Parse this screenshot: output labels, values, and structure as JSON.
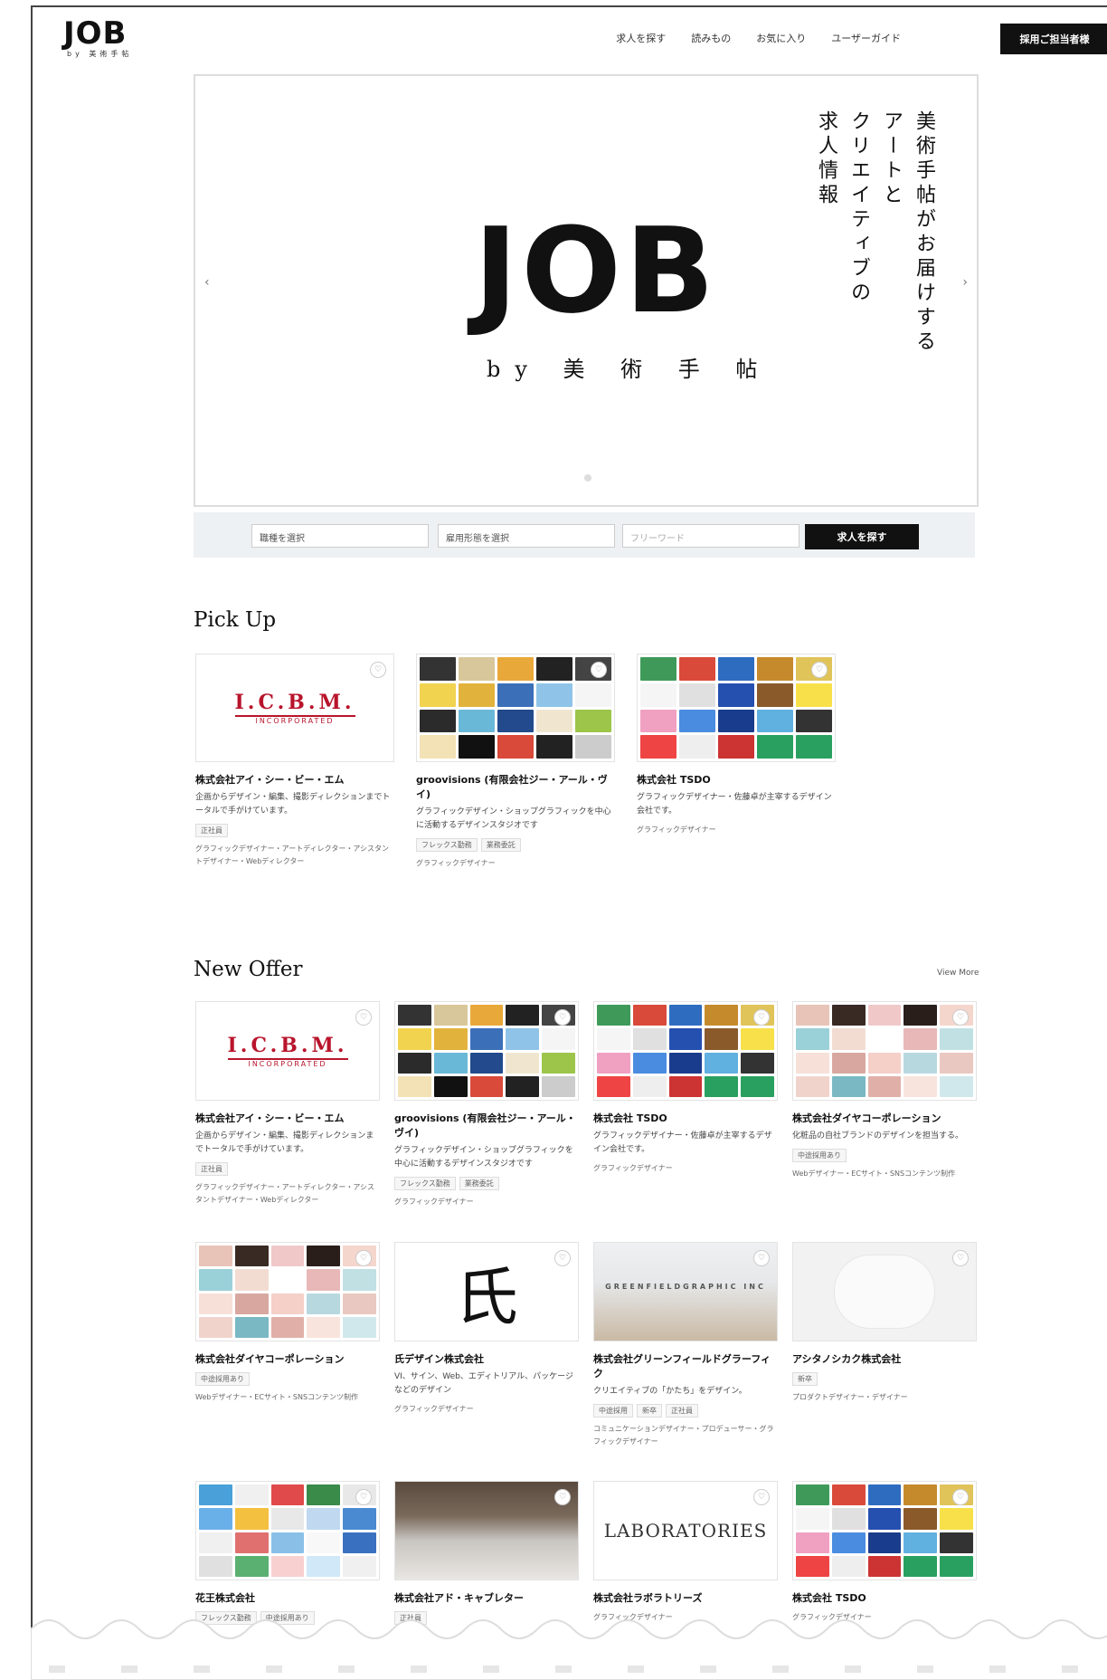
{
  "header": {
    "logo": "JOB",
    "logo_sub": "by 美術手帖",
    "nav": [
      "求人を探す",
      "読みもの",
      "お気に入り",
      "ユーザーガイド"
    ],
    "cta": "採用ご担当者様"
  },
  "hero": {
    "title": "JOB",
    "subtitle": "by 美 術 手 帖",
    "vertical_lines": [
      "美術手帖がお届けする",
      "アートと",
      "クリエイティブの",
      "求人情報"
    ],
    "prev": "‹",
    "next": "›"
  },
  "search": {
    "area_placeholder": "職種を選択",
    "type_placeholder": "雇用形態を選択",
    "keyword_placeholder": "フリーワード",
    "button": "求人を探す"
  },
  "pickup": {
    "title": "Pick Up",
    "cards": [
      {
        "name": "株式会社アイ・シー・ビー・エム",
        "desc": "企画からデザイン・編集、撮影ディレクションまでトータルで手がけています。",
        "tags": [
          "正社員"
        ],
        "meta": "グラフィックデザイナー・アートディレクター・アシスタントデザイナー・Webディレクター"
      },
      {
        "name": "groovisions (有限会社ジー・アール・ヴイ)",
        "desc": "グラフィックデザイン・ショップグラフィックを中心に活動するデザインスタジオです",
        "tags": [
          "フレックス勤務",
          "業務委託"
        ],
        "meta": "グラフィックデザイナー"
      },
      {
        "name": "株式会社 TSDO",
        "desc": "グラフィックデザイナー・佐藤卓が主宰するデザイン会社です。",
        "tags": [],
        "meta": "グラフィックデザイナー"
      }
    ]
  },
  "newoffer": {
    "title": "New Offer",
    "view_more": "View More",
    "cards": [
      {
        "name": "株式会社アイ・シー・ビー・エム",
        "desc": "企画からデザイン・編集、撮影ディレクションまでトータルで手がけています。",
        "tags": [
          "正社員"
        ],
        "meta": "グラフィックデザイナー・アートディレクター・アシスタントデザイナー・Webディレクター"
      },
      {
        "name": "groovisions (有限会社ジー・アール・ヴイ)",
        "desc": "グラフィックデザイン・ショップグラフィックを中心に活動するデザインスタジオです",
        "tags": [
          "フレックス勤務",
          "業務委託"
        ],
        "meta": "グラフィックデザイナー"
      },
      {
        "name": "株式会社 TSDO",
        "desc": "グラフィックデザイナー・佐藤卓が主宰するデザイン会社です。",
        "tags": [],
        "meta": "グラフィックデザイナー"
      },
      {
        "name": "株式会社ダイヤコーポレーション",
        "desc": "化粧品の自社ブランドのデザインを担当する。",
        "tags": [
          "中途採用あり"
        ],
        "meta": "Webデザイナー・ECサイト・SNSコンテンツ制作"
      },
      {
        "name": "株式会社ダイヤコーポレーション",
        "desc": "",
        "tags": [
          "中途採用あり"
        ],
        "meta": "Webデザイナー・ECサイト・SNSコンテンツ制作"
      },
      {
        "name": "氏デザイン株式会社",
        "desc": "VI、サイン、Web、エディトリアル、パッケージなどのデザイン",
        "tags": [],
        "meta": "グラフィックデザイナー"
      },
      {
        "name": "株式会社グリーンフィールドグラーフィク",
        "desc": "クリエイティブの「かたち」をデザイン。",
        "tags": [
          "中途採用",
          "新卒",
          "正社員"
        ],
        "meta": "コミュニケーションデザイナー・プロデューサー・グラフィックデザイナー"
      },
      {
        "name": "アシタノシカク株式会社",
        "desc": "",
        "tags": [
          "新卒"
        ],
        "meta": "プロダクトデザイナー・デザイナー"
      },
      {
        "name": "花王株式会社",
        "desc": "",
        "tags": [
          "フレックス勤務",
          "中途採用あり"
        ],
        "meta": ""
      },
      {
        "name": "株式会社アド・キャブレター",
        "desc": "",
        "tags": [
          "正社員"
        ],
        "meta": ""
      },
      {
        "name": "株式会社ラボラトリーズ",
        "desc": "",
        "tags": [],
        "meta": "グラフィックデザイナー"
      },
      {
        "name": "株式会社 TSDO",
        "desc": "",
        "tags": [],
        "meta": "グラフィックデザイナー"
      }
    ]
  },
  "thumbs": {
    "icbm_title": "I.C.B.M.",
    "icbm_sub": "INCORPORATED",
    "kanji": "氏",
    "greenfield": "GREENFIELDGRAPHIC INC",
    "lab": "LABORATORIES"
  },
  "colors": {
    "accent": "#111111",
    "brand_red": "#b8142b"
  }
}
